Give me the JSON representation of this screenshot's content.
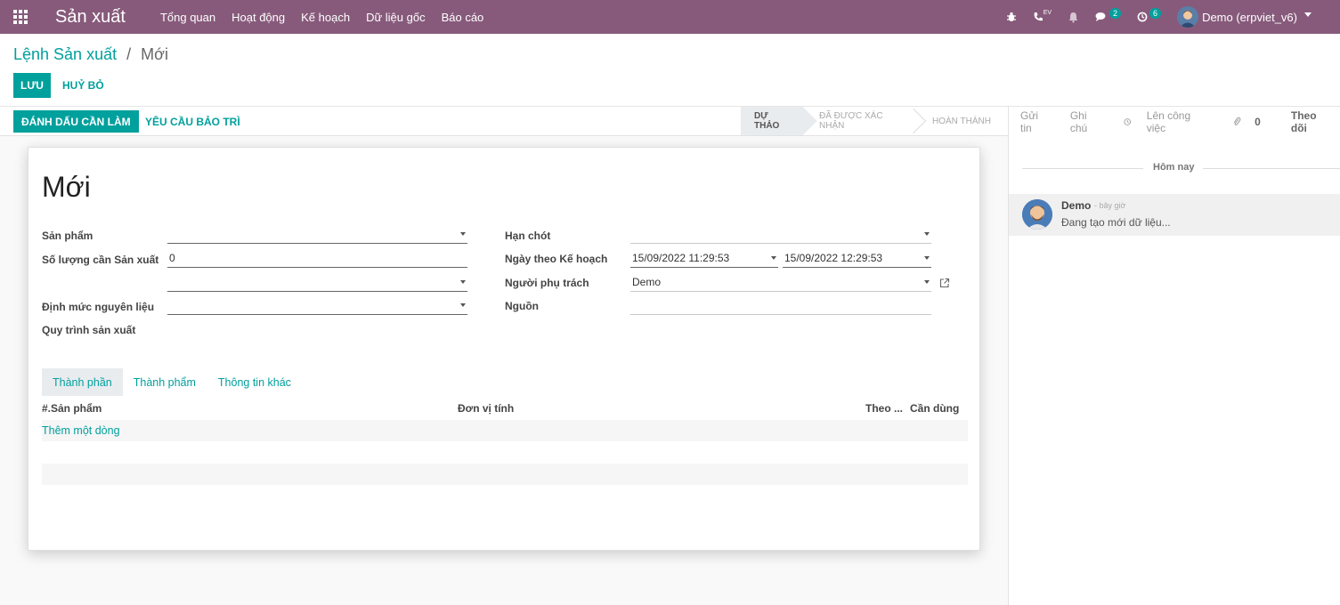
{
  "navbar": {
    "app_title": "Sản xuất",
    "menu": [
      "Tổng quan",
      "Hoạt động",
      "Kế hoạch",
      "Dữ liệu gốc",
      "Báo cáo"
    ],
    "messages_count": "2",
    "activities_count": "6",
    "phone_label": "EV",
    "user_name": "Demo (erpviet_v6)"
  },
  "breadcrumb": {
    "parent": "Lệnh Sản xuất",
    "separator": "/",
    "current": "Mới"
  },
  "actions": {
    "save": "LƯU",
    "discard": "HUỶ BỎ"
  },
  "statusbar": {
    "mark_todo": "ĐÁNH DẤU CẦN LÀM",
    "maintenance": "YÊU CẦU BẢO TRÌ",
    "stages": [
      "DỰ THẢO",
      "ĐÃ ĐƯỢC XÁC NHẬN",
      "HOÀN THÀNH"
    ]
  },
  "form": {
    "title": "Mới",
    "product_label": "Sản phẩm",
    "qty_label": "Số lượng cần Sản xuất",
    "qty_value": "0",
    "bom_label": "Định mức nguyên liệu",
    "routing_label": "Quy trình sản xuất",
    "deadline_label": "Hạn chót",
    "planned_date_label": "Ngày theo Kế hoạch",
    "planned_start": "15/09/2022 11:29:53",
    "planned_end": "15/09/2022 12:29:53",
    "responsible_label": "Người phụ trách",
    "responsible_value": "Demo",
    "source_label": "Nguồn"
  },
  "notebook": {
    "tabs": [
      "Thành phần",
      "Thành phẩm",
      "Thông tin khác"
    ],
    "columns": {
      "product": "#.Sản phẩm",
      "uom": "Đơn vị tính",
      "track": "Theo ...",
      "to_consume": "Cần dùng"
    },
    "add_line": "Thêm một dòng"
  },
  "chatter": {
    "send_message": "Gửi tin",
    "log_note": "Ghi chú",
    "schedule_activity": "Lên công việc",
    "attachments_count": "0",
    "follow": "Theo dõi",
    "day_separator": "Hôm nay",
    "message": {
      "author": "Demo",
      "date": "- bây giờ",
      "body": "Đang tạo mới dữ liệu..."
    }
  },
  "colors": {
    "navbar": "#875a7b",
    "accent": "#00a09d"
  }
}
